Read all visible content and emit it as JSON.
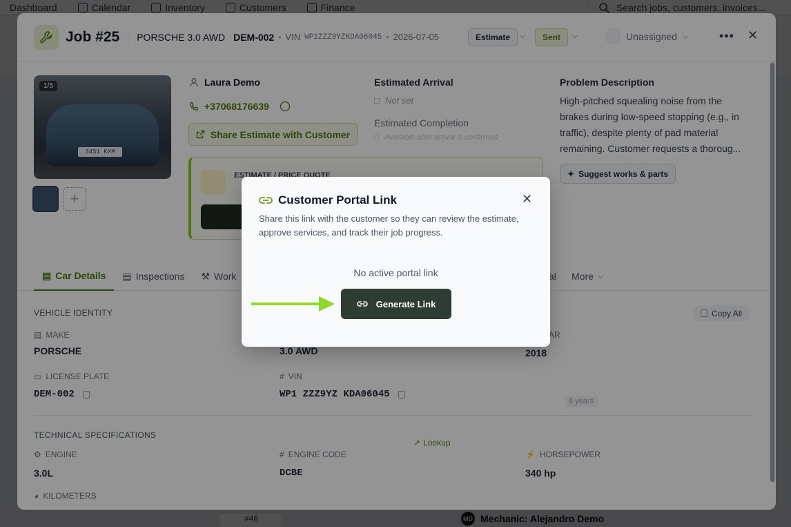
{
  "background": {
    "nav": [
      "Dashboard",
      "Calendar",
      "Inventory",
      "Customers",
      "Finance"
    ],
    "search_placeholder": "Search jobs, customers, invoices...",
    "mechanic": "Mechanic: Alejandro Demo",
    "mechanic_initials": "MD",
    "job48": "#48"
  },
  "job": {
    "title": "Job #25",
    "car_name": "PORSCHE 3.0 AWD",
    "plate": "DEM-002",
    "vin_label": "VIN",
    "vin": "WP1ZZZ9YZKDA06045",
    "date": "2026-07-05",
    "estimate_label": "Estimate",
    "sent_label": "Sent",
    "assignee": "Unassigned",
    "photo_count": "1/5",
    "plate_in_photo": "3451 KXM"
  },
  "customer": {
    "name": "Laura Demo",
    "phone": "+37068176639",
    "share_button": "Share Estimate with Customer"
  },
  "estimate_card": {
    "title": "ESTIMATE / PRICE QUOTE"
  },
  "arrival": {
    "heading": "Estimated Arrival",
    "value": "Not set",
    "completion_heading": "Estimated Completion",
    "completion_value": "Available after arrival is confirmed"
  },
  "problem": {
    "heading": "Problem Description",
    "text": "High-pitched squealing noise from the brakes during low-speed stopping (e.g., in traffic), despite plenty of pad material remaining. Customer requests a thoroug...",
    "suggest_button": "Suggest works & parts"
  },
  "tabs": [
    "Car Details",
    "Inspections",
    "Work"
  ],
  "tab_fragment": "al",
  "tab_more": "More",
  "vehicle": {
    "section": "VEHICLE IDENTITY",
    "copy_all": "Copy All",
    "make_label": "MAKE",
    "make": "PORSCHE",
    "model": "3.0 AWD",
    "year_label_fragment": "AR",
    "year": "2018",
    "years_badge": "8 years",
    "plate_label": "LICENSE PLATE",
    "plate": "DEM-002",
    "vin_label": "VIN",
    "vin": "WP1 ZZZ9YZ KDA06045",
    "lookup": "Lookup"
  },
  "technical": {
    "section": "TECHNICAL SPECIFICATIONS",
    "engine_label": "ENGINE",
    "engine": "3.0L",
    "engine_code_label": "ENGINE CODE",
    "engine_code": "DCBE",
    "horsepower_label": "HORSEPOWER",
    "horsepower": "340 hp",
    "kilometers_label": "KILOMETERS"
  },
  "portal": {
    "title": "Customer Portal Link",
    "description": "Share this link with the customer so they can review the estimate, approve services, and track their job progress.",
    "empty": "No active portal link",
    "generate_button": "Generate Link"
  },
  "colors": {
    "accent": "#4d7c0f",
    "accent_light": "#84cc16",
    "button_dark": "#2e3d33"
  }
}
